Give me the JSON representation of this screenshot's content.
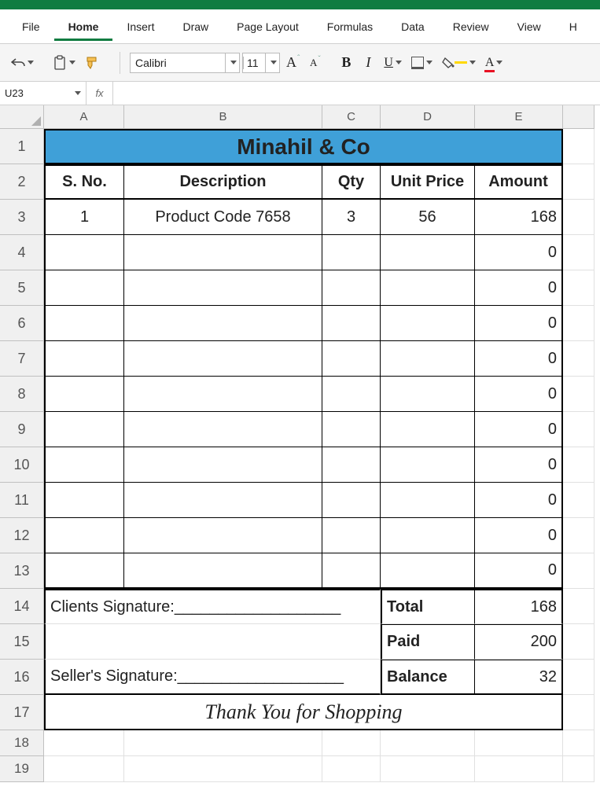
{
  "app": {
    "name": "Excel"
  },
  "tabs": {
    "file": "File",
    "home": "Home",
    "insert": "Insert",
    "draw": "Draw",
    "pagelayout": "Page Layout",
    "formulas": "Formulas",
    "data": "Data",
    "review": "Review",
    "view": "View",
    "h": "H"
  },
  "ribbon": {
    "font_name": "Calibri",
    "font_size": "11"
  },
  "namebox": "U23",
  "fx": "fx",
  "columns": [
    "A",
    "B",
    "C",
    "D",
    "E"
  ],
  "rows": [
    "1",
    "2",
    "3",
    "4",
    "5",
    "6",
    "7",
    "8",
    "9",
    "10",
    "11",
    "12",
    "13",
    "14",
    "15",
    "16",
    "17",
    "18",
    "19"
  ],
  "chart_data": {
    "type": "table",
    "title": "Minahil & Co",
    "columns": [
      "S. No.",
      "Description",
      "Qty",
      "Unit Price",
      "Amount"
    ],
    "rows": [
      {
        "sno": "1",
        "desc": "Product Code 7658",
        "qty": "3",
        "unit": "56",
        "amount": "168"
      },
      {
        "sno": "",
        "desc": "",
        "qty": "",
        "unit": "",
        "amount": "0"
      },
      {
        "sno": "",
        "desc": "",
        "qty": "",
        "unit": "",
        "amount": "0"
      },
      {
        "sno": "",
        "desc": "",
        "qty": "",
        "unit": "",
        "amount": "0"
      },
      {
        "sno": "",
        "desc": "",
        "qty": "",
        "unit": "",
        "amount": "0"
      },
      {
        "sno": "",
        "desc": "",
        "qty": "",
        "unit": "",
        "amount": "0"
      },
      {
        "sno": "",
        "desc": "",
        "qty": "",
        "unit": "",
        "amount": "0"
      },
      {
        "sno": "",
        "desc": "",
        "qty": "",
        "unit": "",
        "amount": "0"
      },
      {
        "sno": "",
        "desc": "",
        "qty": "",
        "unit": "",
        "amount": "0"
      },
      {
        "sno": "",
        "desc": "",
        "qty": "",
        "unit": "",
        "amount": "0"
      },
      {
        "sno": "",
        "desc": "",
        "qty": "",
        "unit": "",
        "amount": "0"
      }
    ],
    "clients_sig": "Clients Signature:___________________",
    "sellers_sig": "Seller's Signature:___________________",
    "totals": {
      "total_label": "Total",
      "total": "168",
      "paid_label": "Paid",
      "paid": "200",
      "balance_label": "Balance",
      "balance": "32"
    },
    "thanks": "Thank You for Shopping"
  }
}
